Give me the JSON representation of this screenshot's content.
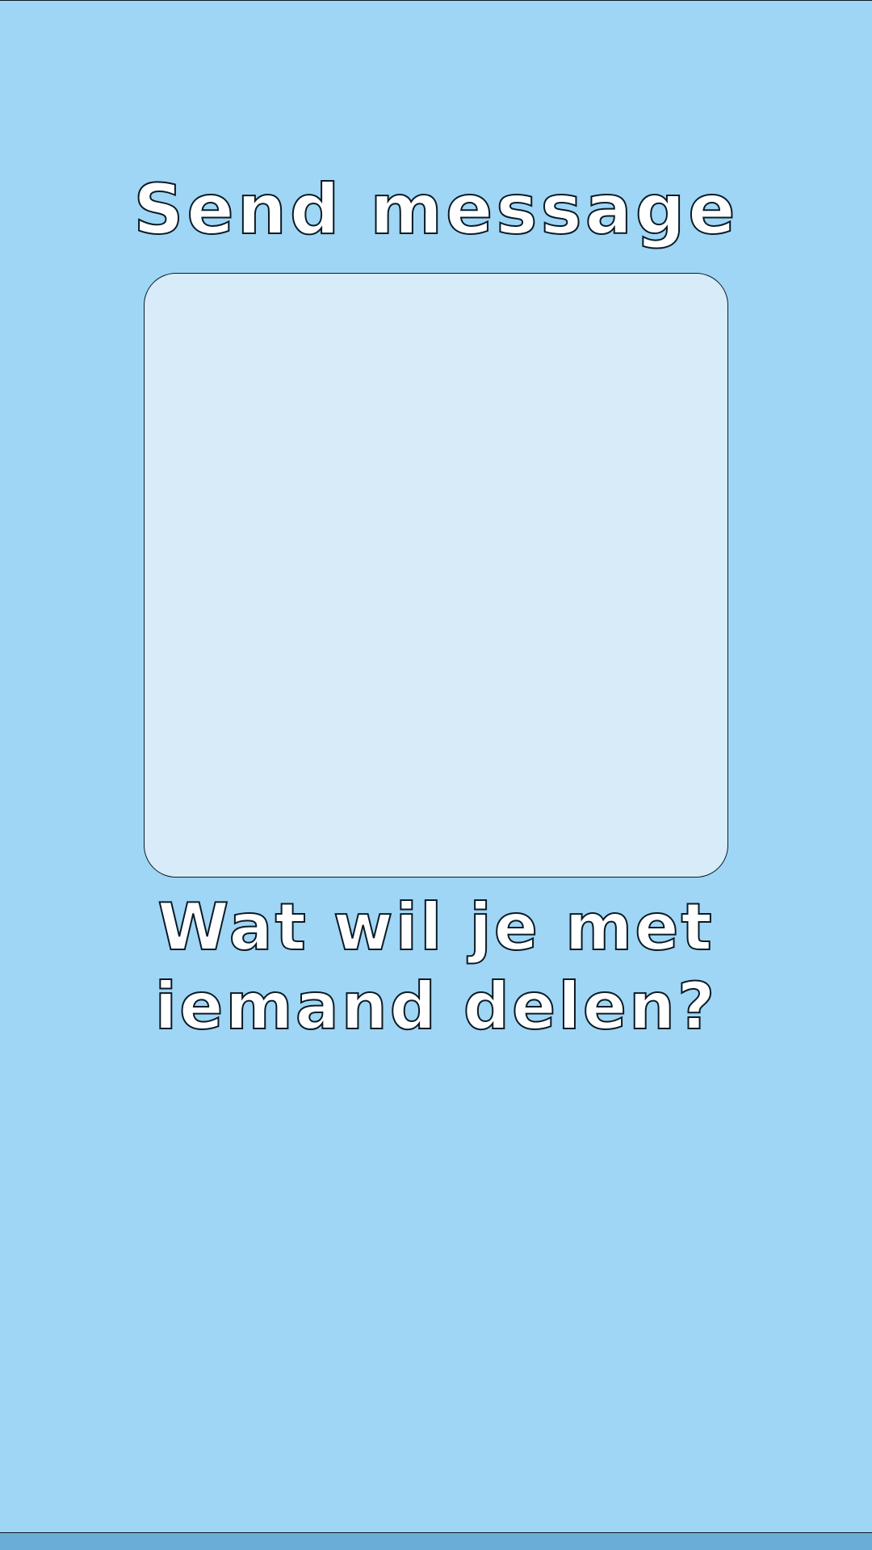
{
  "header": {
    "title": "Send message"
  },
  "composer": {
    "value": "",
    "placeholder": ""
  },
  "prompt": {
    "line1": "Wat wil je met",
    "line2": "iemand delen?"
  },
  "colors": {
    "background": "#9fd6f6",
    "message_area": "#d7ebf8",
    "text_fill": "#ffffff",
    "outline": "#0b1a24",
    "bottom_bar": "#6aaed6"
  }
}
